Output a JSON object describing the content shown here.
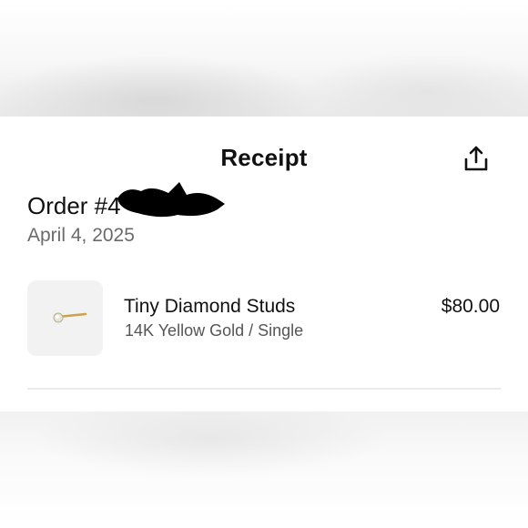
{
  "header": {
    "title": "Receipt",
    "share_icon": "share-icon"
  },
  "order": {
    "number_prefix": "Order #4",
    "date": "April 4, 2025"
  },
  "items": [
    {
      "name": "Tiny Diamond Studs",
      "variant": "14K Yellow Gold / Single",
      "price": "$80.00",
      "image_icon": "earring-stud-icon"
    }
  ],
  "colors": {
    "text_primary": "#111111",
    "text_secondary": "#6b6b6b",
    "thumb_background": "#f2f2f2",
    "divider": "#eaeaea",
    "redaction": "#000000"
  }
}
